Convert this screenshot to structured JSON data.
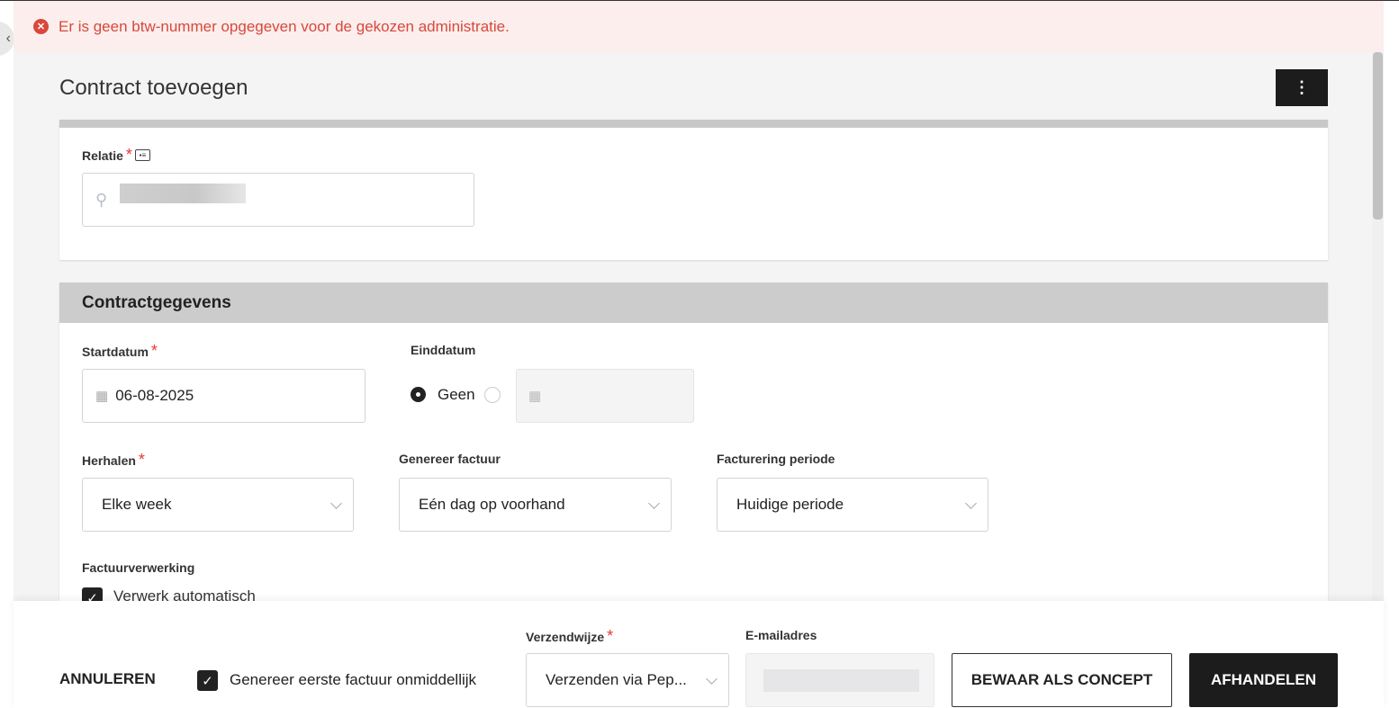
{
  "error_banner": {
    "message": "Er is geen btw-nummer opgegeven voor de gekozen administratie.",
    "color": "#d9483b"
  },
  "header": {
    "title": "Contract toevoegen",
    "menu_icon": "kebab-icon"
  },
  "relatie": {
    "label": "Relatie",
    "required": "*",
    "value": ""
  },
  "section": {
    "title": "Contractgegevens"
  },
  "startdatum": {
    "label": "Startdatum",
    "required": "*",
    "value": "06-08-2025"
  },
  "einddatum": {
    "label": "Einddatum",
    "option_none": "Geen",
    "selected": "Geen",
    "value": ""
  },
  "herhalen": {
    "label": "Herhalen",
    "required": "*",
    "value": "Elke week"
  },
  "genereer_factuur": {
    "label": "Genereer factuur",
    "value": "Eén dag op voorhand"
  },
  "facturering_periode": {
    "label": "Facturering periode",
    "value": "Huidige periode"
  },
  "factuurverwerking": {
    "label": "Factuurverwerking",
    "checkbox_label": "Verwerk automatisch",
    "checked": true
  },
  "footer": {
    "cancel": "ANNULEREN",
    "first_invoice_label": "Genereer eerste factuur onmiddellijk",
    "first_invoice_checked": true,
    "verzendwijze_label": "Verzendwijze",
    "verzendwijze_required": "*",
    "verzendwijze_value": "Verzenden via Pep...",
    "email_label": "E-mailadres",
    "email_value": "",
    "save_draft": "BEWAAR ALS CONCEPT",
    "submit": "AFHANDELEN"
  }
}
